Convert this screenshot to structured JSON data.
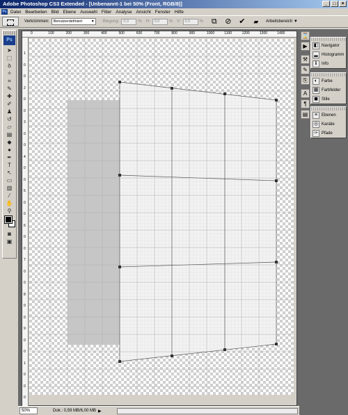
{
  "window": {
    "title": "Adobe Photoshop CS3 Extended - [Unbenannt-1 bei 50% (Front, RGB/8)]",
    "controls": [
      "_",
      "□",
      "×"
    ]
  },
  "menubar": {
    "app_icon": "Ps",
    "items": [
      "Datei",
      "Bearbeiten",
      "Bild",
      "Ebene",
      "Auswahl",
      "Filter",
      "Analyse",
      "Ansicht",
      "Fenster",
      "Hilfe"
    ]
  },
  "options": {
    "warp_label": "Verkrümmen:",
    "warp_value": "Benutzerdefiniert",
    "bend_label": "Biegung:",
    "bend_value": "0,0",
    "h_label": "H:",
    "h_value": "0,0",
    "v_label": "V:",
    "v_value": "0,0",
    "unit": "%",
    "workspace_label": "Arbeitsbereich ▼",
    "icons": [
      "transform-toggle-icon",
      "cancel-icon",
      "commit-icon"
    ]
  },
  "toolbox": {
    "logo": "Ps",
    "tools": [
      {
        "name": "move-tool-icon",
        "glyph": "➤"
      },
      {
        "name": "marquee-tool-icon",
        "glyph": "⬚"
      },
      {
        "name": "lasso-tool-icon",
        "glyph": "ꝺ"
      },
      {
        "name": "magic-wand-tool-icon",
        "glyph": "✧"
      },
      {
        "name": "crop-tool-icon",
        "glyph": "⌗"
      },
      {
        "name": "slice-tool-icon",
        "glyph": "✎"
      },
      {
        "name": "healing-brush-tool-icon",
        "glyph": "✚"
      },
      {
        "name": "brush-tool-icon",
        "glyph": "✐"
      },
      {
        "name": "clone-stamp-tool-icon",
        "glyph": "♟"
      },
      {
        "name": "history-brush-tool-icon",
        "glyph": "↺"
      },
      {
        "name": "eraser-tool-icon",
        "glyph": "▱"
      },
      {
        "name": "gradient-tool-icon",
        "glyph": "▤"
      },
      {
        "name": "blur-tool-icon",
        "glyph": "◆"
      },
      {
        "name": "dodge-tool-icon",
        "glyph": "●"
      },
      {
        "name": "pen-tool-icon",
        "glyph": "✒"
      },
      {
        "name": "type-tool-icon",
        "glyph": "T"
      },
      {
        "name": "path-selection-tool-icon",
        "glyph": "↖"
      },
      {
        "name": "shape-tool-icon",
        "glyph": "▭"
      },
      {
        "name": "notes-tool-icon",
        "glyph": "▥"
      },
      {
        "name": "eyedropper-tool-icon",
        "glyph": "⁄"
      },
      {
        "name": "hand-tool-icon",
        "glyph": "✋"
      },
      {
        "name": "zoom-tool-icon",
        "glyph": "⚲"
      }
    ],
    "bottom_tools": [
      {
        "name": "quick-mask-icon",
        "glyph": "◙"
      },
      {
        "name": "screen-mode-icon",
        "glyph": "▣"
      }
    ]
  },
  "rulers": {
    "top": [
      "0",
      "100",
      "200",
      "300",
      "400",
      "500",
      "600",
      "700",
      "800",
      "900",
      "1000",
      "1100",
      "1200",
      "1300",
      "1400"
    ],
    "left": [
      "1",
      "0",
      "0",
      "2",
      "0",
      "0",
      "3",
      "0",
      "0",
      "4",
      "0",
      "0",
      "5",
      "0",
      "0",
      "6",
      "0",
      "0",
      "7",
      "0",
      "0",
      "8",
      "0",
      "0",
      "9",
      "0",
      "0",
      "1",
      "0",
      "0",
      "0"
    ]
  },
  "status": {
    "zoom": "50%",
    "doc_info": "Dok.: 0,59 MB/6,00 MB",
    "arrow": "▶"
  },
  "dock": {
    "groups": [
      [
        "history-icon",
        "actions-icon"
      ],
      [
        "tool-presets-icon",
        "brushes-icon",
        "clone-source-icon"
      ],
      [
        "character-icon",
        "paragraph-icon",
        "layer-comps-icon"
      ]
    ]
  },
  "panels": [
    {
      "rows": [
        {
          "icon": "navigator-icon",
          "label": "Navigator"
        },
        {
          "icon": "histogram-icon",
          "label": "Histogramm"
        },
        {
          "icon": "info-icon",
          "label": "Info"
        }
      ]
    },
    {
      "rows": [
        {
          "icon": "color-icon",
          "label": "Farbe"
        },
        {
          "icon": "swatches-icon",
          "label": "Farbfelder"
        },
        {
          "icon": "styles-icon",
          "label": "Stile"
        }
      ]
    },
    {
      "rows": [
        {
          "icon": "layers-icon",
          "label": "Ebenen"
        },
        {
          "icon": "channels-icon",
          "label": "Kanäle"
        },
        {
          "icon": "paths-icon",
          "label": "Pfade"
        }
      ]
    }
  ]
}
